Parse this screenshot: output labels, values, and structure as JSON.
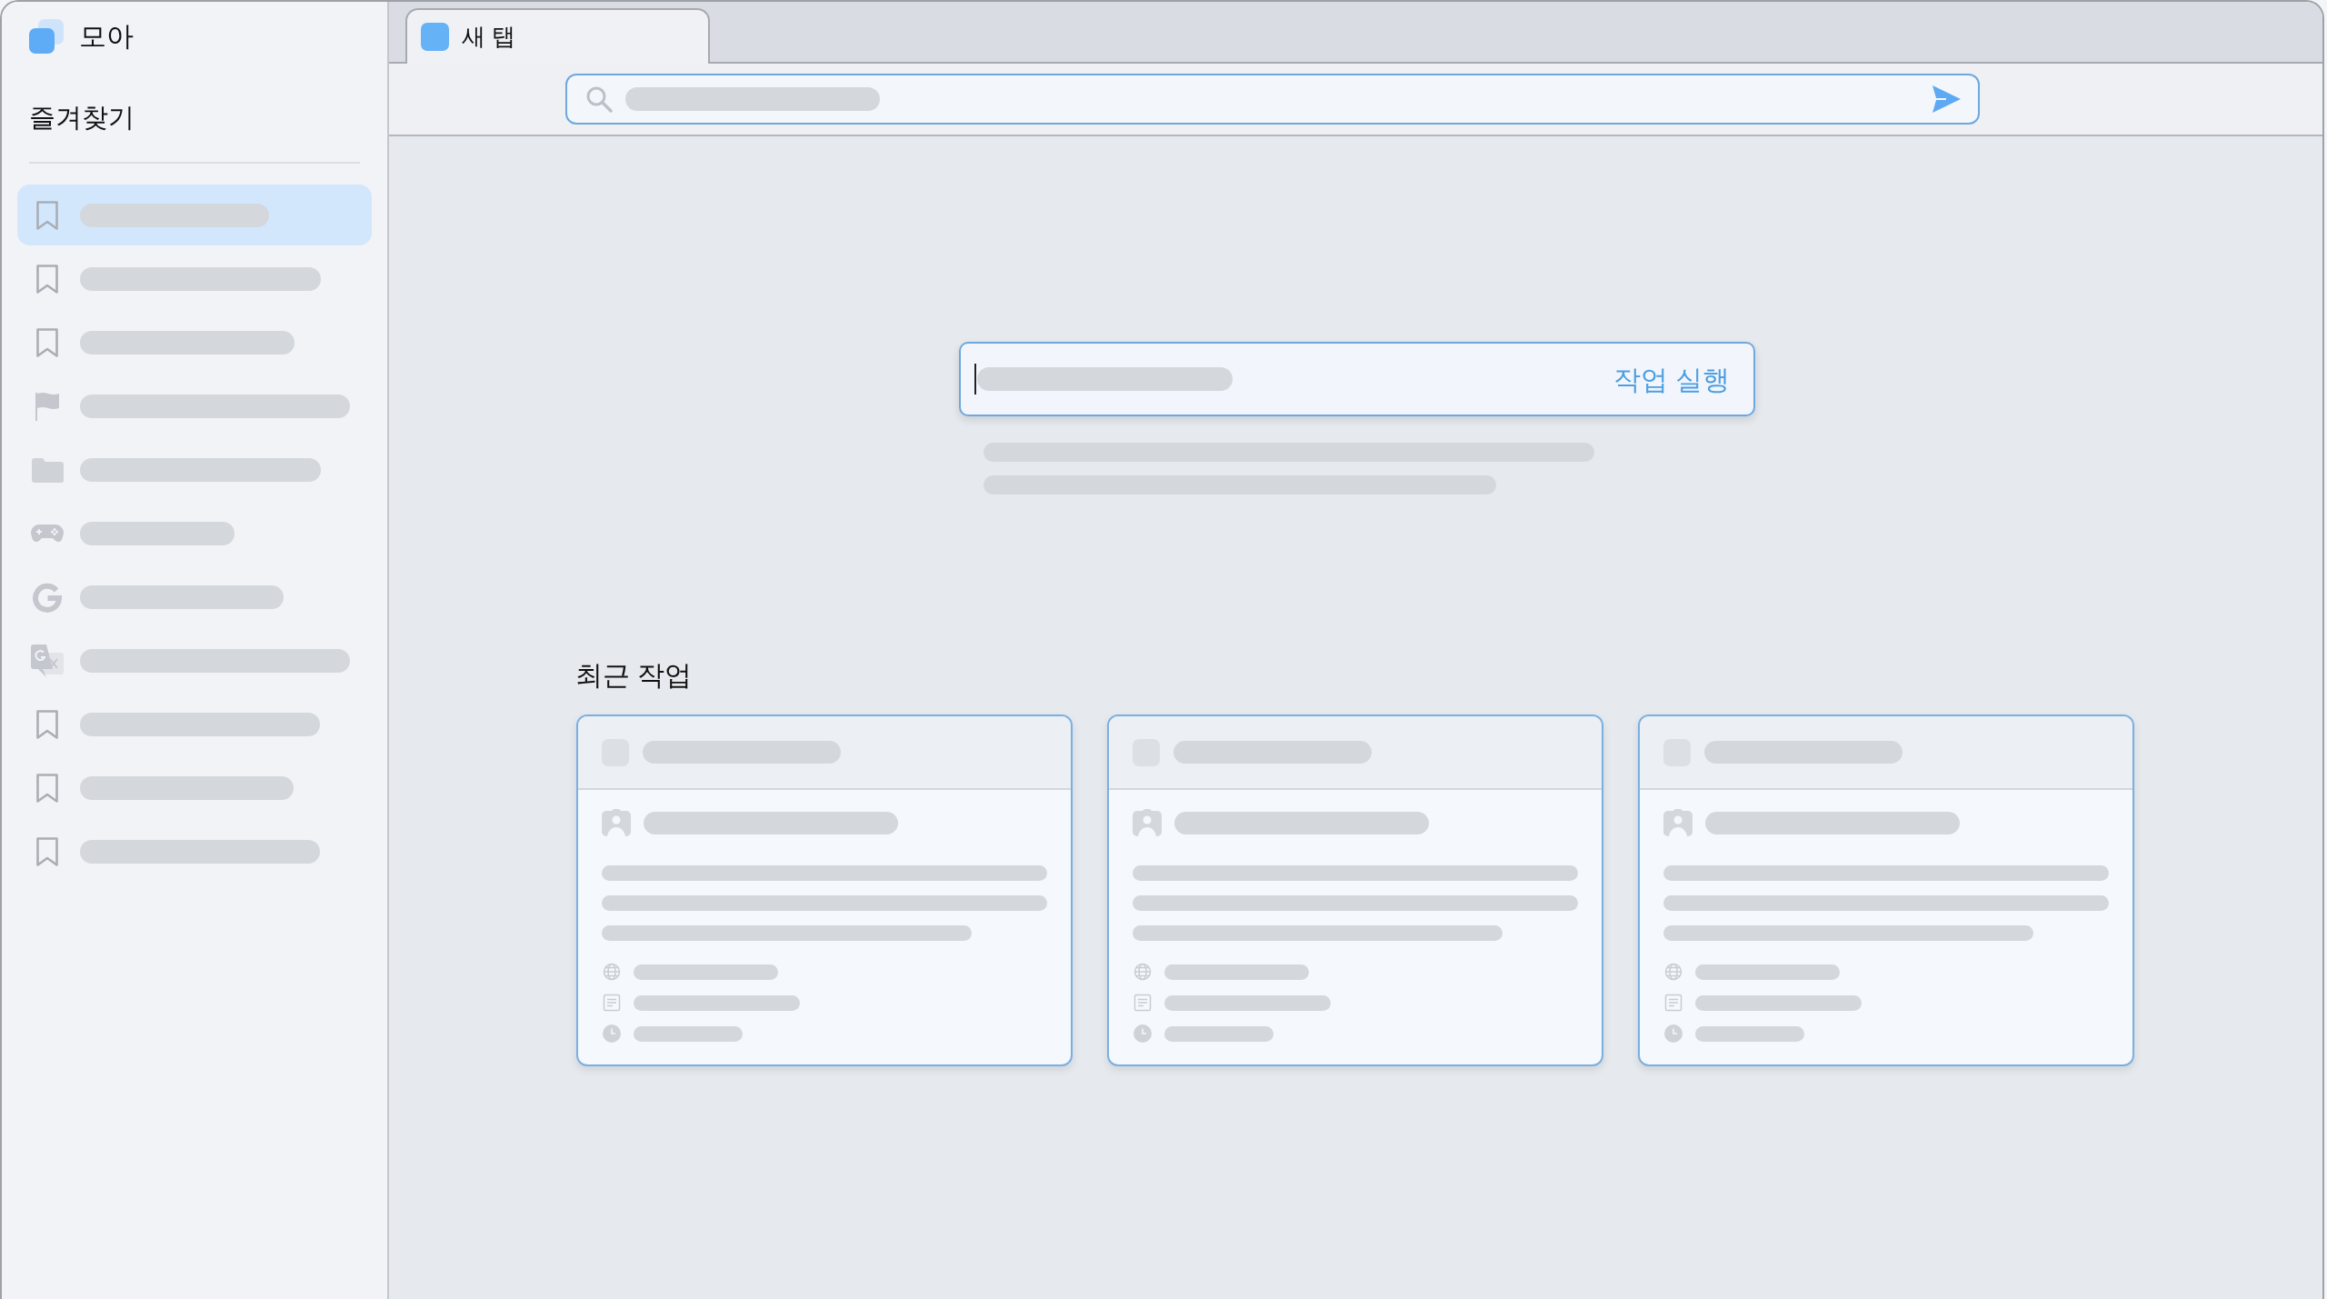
{
  "app": {
    "name": "모아"
  },
  "sidebar": {
    "heading": "즐겨찾기",
    "items": [
      {
        "kind": "bookmark",
        "selected": true
      },
      {
        "kind": "bookmark",
        "selected": false
      },
      {
        "kind": "bookmark",
        "selected": false
      },
      {
        "kind": "flag",
        "selected": false
      },
      {
        "kind": "folder",
        "selected": false
      },
      {
        "kind": "gamepad",
        "selected": false
      },
      {
        "kind": "glogo",
        "selected": false
      },
      {
        "kind": "translate",
        "selected": false
      },
      {
        "kind": "bookmark",
        "selected": false
      },
      {
        "kind": "bookmark",
        "selected": false
      },
      {
        "kind": "bookmark",
        "selected": false
      }
    ]
  },
  "tabs": [
    {
      "label": "새 탭",
      "selected": true
    }
  ],
  "task_input": {
    "focused": true,
    "action": "작업 실행"
  },
  "recent_tasks": {
    "title": "최근 작업",
    "cards": [
      {
        "kind": "skeleton"
      },
      {
        "kind": "skeleton"
      },
      {
        "kind": "skeleton"
      }
    ]
  }
}
